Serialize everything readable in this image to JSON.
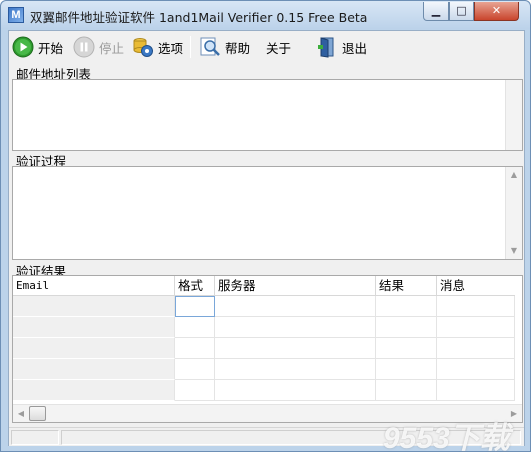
{
  "window": {
    "title": "双翼邮件地址验证软件 1and1Mail Verifier 0.15 Free Beta",
    "app_icon": "M",
    "minimize": "▁",
    "maximize": "□",
    "close": "✕"
  },
  "toolbar": {
    "start_label": "开始",
    "stop_label": "停止",
    "options_label": "选项",
    "help_label": "帮助",
    "about_label": "关于",
    "exit_label": "退出"
  },
  "sections": {
    "email_list": "邮件地址列表",
    "process": "验证过程",
    "results": "验证结果"
  },
  "results_table": {
    "columns": [
      "Email",
      "格式",
      "服务器",
      "结果",
      "消息"
    ],
    "row_count": 5
  },
  "colors": {
    "titlebar": "#bcd2ea",
    "client_bg": "#f0f0f0",
    "close_button": "#c9452d",
    "start_icon": "#2e9a2e"
  },
  "watermark": "9553下载"
}
